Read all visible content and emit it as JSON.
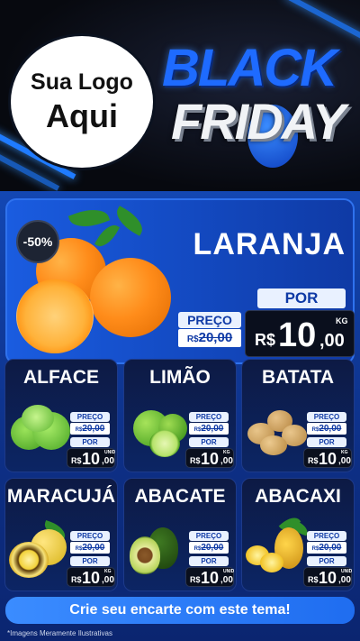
{
  "header": {
    "logo_line1": "Sua Logo",
    "logo_line2": "Aqui",
    "brand_line1": "BLACK",
    "brand_line2": "FRIDAY"
  },
  "hero": {
    "product": "LARANJA",
    "discount": "-50%",
    "preco_label": "PREÇO",
    "old_currency": "R$",
    "old_price": "20,00",
    "por_label": "POR",
    "currency": "R$",
    "price_int": "10",
    "price_cents": ",00",
    "unit": "KG"
  },
  "cards": [
    {
      "name": "ALFACE",
      "preco_label": "PREÇO",
      "old_currency": "R$",
      "old_price": "20,00",
      "por_label": "POR",
      "currency": "R$",
      "price_int": "10",
      "price_cents": ",00",
      "unit": "UNID"
    },
    {
      "name": "LIMÃO",
      "preco_label": "PREÇO",
      "old_currency": "R$",
      "old_price": "20,00",
      "por_label": "POR",
      "currency": "R$",
      "price_int": "10",
      "price_cents": ",00",
      "unit": "KG"
    },
    {
      "name": "BATATA",
      "preco_label": "PREÇO",
      "old_currency": "R$",
      "old_price": "20,00",
      "por_label": "POR",
      "currency": "R$",
      "price_int": "10",
      "price_cents": ",00",
      "unit": "KG"
    },
    {
      "name": "MARACUJÁ",
      "preco_label": "PREÇO",
      "old_currency": "R$",
      "old_price": "20,00",
      "por_label": "POR",
      "currency": "R$",
      "price_int": "10",
      "price_cents": ",00",
      "unit": "KG"
    },
    {
      "name": "ABACATE",
      "preco_label": "PREÇO",
      "old_currency": "R$",
      "old_price": "20,00",
      "por_label": "POR",
      "currency": "R$",
      "price_int": "10",
      "price_cents": ",00",
      "unit": "UNID"
    },
    {
      "name": "ABACAXI",
      "preco_label": "PREÇO",
      "old_currency": "R$",
      "old_price": "20,00",
      "por_label": "POR",
      "currency": "R$",
      "price_int": "10",
      "price_cents": ",00",
      "unit": "UNID"
    }
  ],
  "footer": {
    "cta": "Crie seu encarte com este tema!",
    "disclaimer": "*Imagens Meramente Ilustrativas"
  },
  "colors": {
    "accent_blue": "#1e6bff",
    "panel_blue": "#1349c0",
    "card_navy": "#0d1a44",
    "price_black": "#0a0f1d"
  }
}
